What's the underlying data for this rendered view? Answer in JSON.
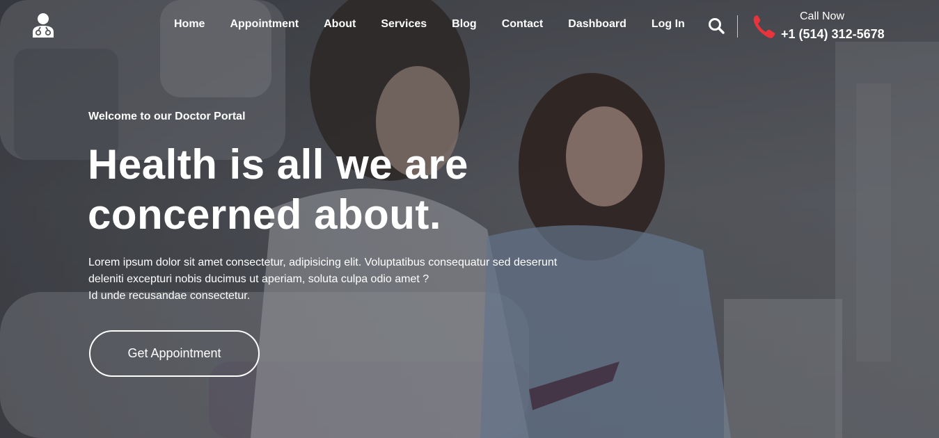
{
  "nav": {
    "items": [
      {
        "label": "Home"
      },
      {
        "label": "Appointment"
      },
      {
        "label": "About"
      },
      {
        "label": "Services"
      },
      {
        "label": "Blog"
      },
      {
        "label": "Contact"
      },
      {
        "label": "Dashboard"
      },
      {
        "label": "Log In"
      }
    ]
  },
  "header": {
    "logo_icon": "doctor-stethoscope-icon",
    "search_icon": "search-icon",
    "phone_icon": "phone-icon",
    "call_label": "Call Now",
    "call_number": "+1 (514) 312-5678"
  },
  "hero": {
    "welcome": "Welcome to our Doctor Portal",
    "headline_line1": "Health is all we are",
    "headline_line2": "concerned about.",
    "description_line1": "Lorem ipsum dolor sit amet consectetur, adipisicing elit. Voluptatibus consequatur sed deserunt",
    "description_line2": "deleniti excepturi nobis ducimus ut aperiam, soluta culpa odio amet ?",
    "description_line3": "Id unde recusandae consectetur.",
    "cta_label": "Get Appointment"
  },
  "colors": {
    "accent_phone": "#e8343a",
    "text": "#ffffff",
    "overlay": "#14161c"
  }
}
